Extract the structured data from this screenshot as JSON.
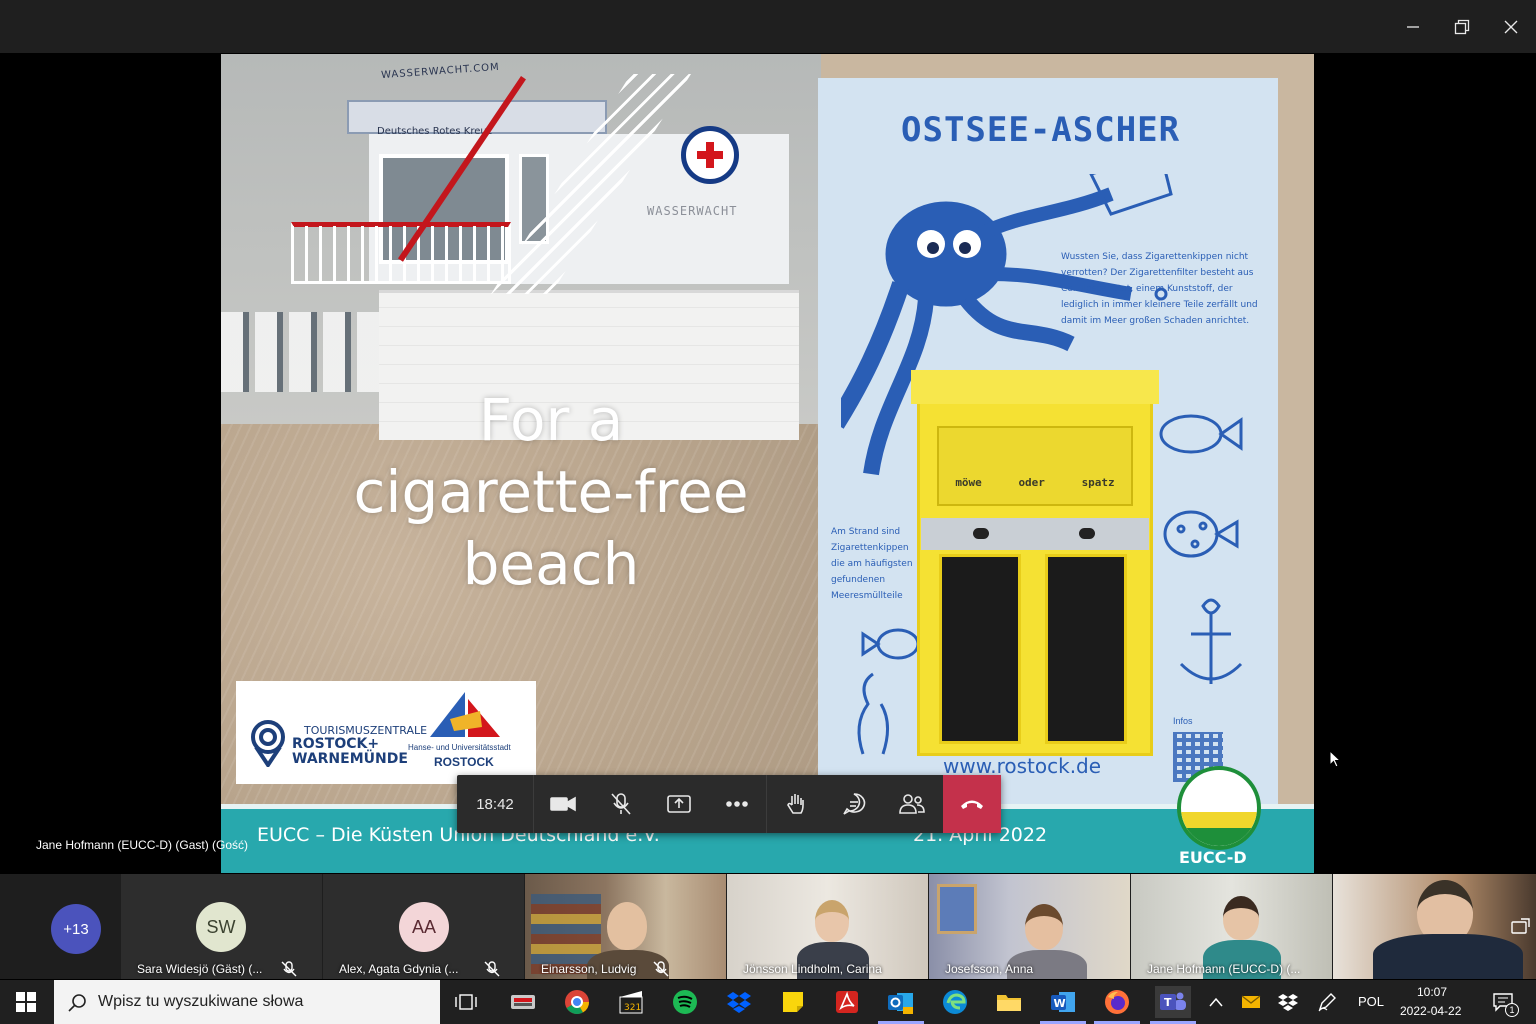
{
  "slide": {
    "heading_line1": "For a",
    "heading_line2": "cigarette-free",
    "heading_line3": "beach",
    "tower_sign_top": "WASSERWACHT.COM",
    "tower_sign_mid": "Deutsches Rotes Kreuz",
    "tower_sign_wall": "WASSERWACHT",
    "board_title": "OSTSEE-ASCHER",
    "board_text": "Wussten Sie, dass Zigarettenkippen nicht verrotten? Der Zigarettenfilter besteht aus Celluloseacetat, einem Kunststoff, der lediglich in immer kleinere Teile zerfällt und damit im Meer großen Schaden anrichtet.",
    "board_text2": "Am Strand sind Zigarettenkippen die am häufigsten gefundenen Meeresmüllteile",
    "ashtray_label_left": "möwe",
    "ashtray_label_mid": "oder",
    "ashtray_label_right": "spatz",
    "board_url": "www.rostock.de",
    "board_infos": "Infos",
    "logo_tourism_1": "TOURISMUSZENTRALE",
    "logo_tourism_2": "ROSTOCK+",
    "logo_tourism_3": "WARNEMÜNDE",
    "logo_hanse_1": "Hanse- und Universitätsstadt",
    "logo_hanse_2": "ROSTOCK",
    "footer_org": "EUCC – Die Küsten Union Deutschland e.V.",
    "footer_date": "21. April 2022",
    "eucc_label": "EUCC-D"
  },
  "presenter_label": "Jane Hofmann (EUCC-D) (Gast) (Gość)",
  "controls": {
    "time": "18:42",
    "buttons": [
      "camera",
      "microphone-muted",
      "share",
      "more",
      "raise-hand",
      "chat",
      "participants",
      "leave"
    ]
  },
  "participants": {
    "overflow": "+13",
    "tiles": [
      {
        "initials": "SW",
        "name": "Sara Widesjö (Gäst) (...",
        "muted": true
      },
      {
        "initials": "AA",
        "name": "Alex, Agata Gdynia (...",
        "muted": true
      },
      {
        "name": "Einarsson, Ludvig",
        "muted": true
      },
      {
        "name": "Jönsson Lindholm, Carina",
        "muted": false
      },
      {
        "name": "Josefsson, Anna",
        "muted": false
      },
      {
        "name": "Jane Hofmann (EUCC-D) (...",
        "muted": false
      },
      {
        "name": "",
        "muted": false
      }
    ]
  },
  "taskbar": {
    "search_placeholder": "Wpisz tu wyszukiwane słowa",
    "language": "POL",
    "time": "10:07",
    "date": "2022-04-22",
    "notifications": "1"
  },
  "colors": {
    "titlebar": "#1f1f1f",
    "leave": "#c4314b",
    "teal_band": "#28a8ad",
    "board_blue": "#2a5eb5",
    "ashtray_yellow": "#f5e133",
    "taskbar": "#202020"
  }
}
